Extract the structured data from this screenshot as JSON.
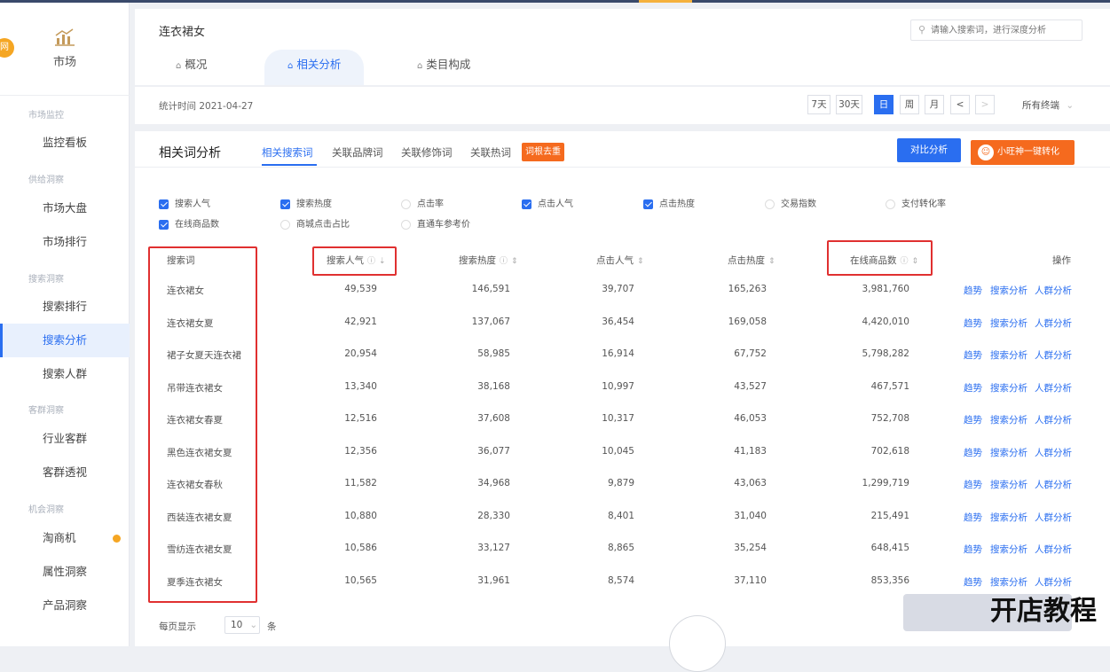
{
  "sidebar": {
    "badge": "网",
    "app_label": "市场",
    "sections": [
      {
        "label": "市场监控"
      },
      {
        "label": "供给洞察"
      },
      {
        "label": "搜索洞察"
      },
      {
        "label": "客群洞察"
      },
      {
        "label": "机会洞察"
      }
    ],
    "items": [
      {
        "label": "监控看板"
      },
      {
        "label": "市场大盘"
      },
      {
        "label": "市场排行"
      },
      {
        "label": "搜索排行"
      },
      {
        "label": "搜索分析",
        "active": true
      },
      {
        "label": "搜索人群"
      },
      {
        "label": "行业客群"
      },
      {
        "label": "客群透视"
      },
      {
        "label": "淘商机"
      },
      {
        "label": "属性洞察"
      },
      {
        "label": "产品洞察"
      }
    ]
  },
  "header": {
    "title": "连衣裙女",
    "search_placeholder": "请输入搜索词，进行深度分析",
    "tabs": [
      {
        "label": "概况"
      },
      {
        "label": "相关分析",
        "active": true
      },
      {
        "label": "类目构成"
      }
    ]
  },
  "daterow": {
    "stat_time": "统计时间 2021-04-27",
    "buttons": [
      "7天",
      "30天",
      "日",
      "周",
      "月"
    ],
    "active_button": "日",
    "prev": "<",
    "next": ">",
    "terminal": "所有终端"
  },
  "main": {
    "title": "相关词分析",
    "subtabs": [
      "相关搜索词",
      "关联品牌词",
      "关联修饰词",
      "关联热词"
    ],
    "active_subtab": "相关搜索词",
    "dedupe_tag": "词根去重",
    "compare_button": "对比分析",
    "convert_button": "小旺神一键转化",
    "metrics": [
      {
        "label": "搜索人气",
        "checked": true
      },
      {
        "label": "搜索热度",
        "checked": true
      },
      {
        "label": "点击率",
        "checked": false
      },
      {
        "label": "点击人气",
        "checked": true
      },
      {
        "label": "点击热度",
        "checked": true
      },
      {
        "label": "交易指数",
        "checked": false
      },
      {
        "label": "支付转化率",
        "checked": false
      },
      {
        "label": "在线商品数",
        "checked": true
      },
      {
        "label": "商城点击占比",
        "checked": false
      },
      {
        "label": "直通车参考价",
        "checked": false
      }
    ],
    "columns": [
      "搜索词",
      "搜索人气",
      "搜索热度",
      "点击人气",
      "点击热度",
      "在线商品数",
      "操作"
    ],
    "rows": [
      {
        "kw": "连衣裙女",
        "v1": "49,539",
        "v2": "146,591",
        "v3": "39,707",
        "v4": "165,263",
        "v5": "3,981,760"
      },
      {
        "kw": "连衣裙女夏",
        "v1": "42,921",
        "v2": "137,067",
        "v3": "36,454",
        "v4": "169,058",
        "v5": "4,420,010"
      },
      {
        "kw": "裙子女夏天连衣裙",
        "v1": "20,954",
        "v2": "58,985",
        "v3": "16,914",
        "v4": "67,752",
        "v5": "5,798,282"
      },
      {
        "kw": "吊带连衣裙女",
        "v1": "13,340",
        "v2": "38,168",
        "v3": "10,997",
        "v4": "43,527",
        "v5": "467,571"
      },
      {
        "kw": "连衣裙女春夏",
        "v1": "12,516",
        "v2": "37,608",
        "v3": "10,317",
        "v4": "46,053",
        "v5": "752,708"
      },
      {
        "kw": "黑色连衣裙女夏",
        "v1": "12,356",
        "v2": "36,077",
        "v3": "10,045",
        "v4": "41,183",
        "v5": "702,618"
      },
      {
        "kw": "连衣裙女春秋",
        "v1": "11,582",
        "v2": "34,968",
        "v3": "9,879",
        "v4": "43,063",
        "v5": "1,299,719"
      },
      {
        "kw": "西装连衣裙女夏",
        "v1": "10,880",
        "v2": "28,330",
        "v3": "8,401",
        "v4": "31,040",
        "v5": "215,491"
      },
      {
        "kw": "雪纺连衣裙女夏",
        "v1": "10,586",
        "v2": "33,127",
        "v3": "8,865",
        "v4": "35,254",
        "v5": "648,415"
      },
      {
        "kw": "夏季连衣裙女",
        "v1": "10,565",
        "v2": "31,961",
        "v3": "8,574",
        "v4": "37,110",
        "v5": "853,356"
      }
    ],
    "actions": [
      "趋势",
      "搜索分析",
      "人群分析"
    ],
    "pager": {
      "prefix": "每页显示",
      "size": "10",
      "suffix": "条"
    }
  },
  "watermark": "开店教程",
  "colors": {
    "accent": "#2a6ef0",
    "orange": "#f56a1e",
    "highlight": "#e03030"
  }
}
